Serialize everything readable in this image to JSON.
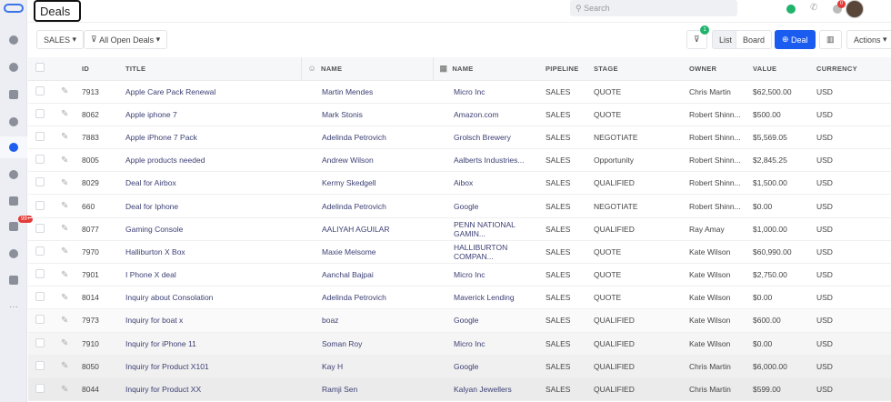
{
  "header": {
    "title": "Deals",
    "search_placeholder": "Search",
    "notification_count": "0"
  },
  "sidebar": {
    "badge": "99+",
    "items": [
      "home",
      "contacts",
      "companies",
      "tasks",
      "deals",
      "products",
      "email",
      "inbox",
      "chat",
      "reports",
      "more"
    ]
  },
  "toolbar": {
    "pipeline": "SALES",
    "filter_view": "All Open Deals",
    "filter_count": "1",
    "list": "List",
    "board": "Board",
    "add_deal": "Deal",
    "actions": "Actions"
  },
  "table": {
    "columns": [
      "ID",
      "TITLE",
      "NAME",
      "NAME",
      "PIPELINE",
      "STAGE",
      "OWNER",
      "VALUE",
      "CURRENCY"
    ],
    "rows": [
      [
        "7913",
        "Apple Care Pack Renewal",
        "Martin Mendes",
        "Micro Inc",
        "SALES",
        "QUOTE",
        "Chris Martin",
        "$62,500.00",
        "USD"
      ],
      [
        "8062",
        "Apple iphone 7",
        "Mark Stonis",
        "Amazon.com",
        "SALES",
        "QUOTE",
        "Robert Shinn...",
        "$500.00",
        "USD"
      ],
      [
        "7883",
        "Apple iPhone 7 Pack",
        "Adelinda Petrovich",
        "Grolsch Brewery",
        "SALES",
        "NEGOTIATE",
        "Robert Shinn...",
        "$5,569.05",
        "USD"
      ],
      [
        "8005",
        "Apple products needed",
        "Andrew Wilson",
        "Aalberts Industries...",
        "SALES",
        "Opportunity",
        "Robert Shinn...",
        "$2,845.25",
        "USD"
      ],
      [
        "8029",
        "Deal for Airbox",
        "Kermy Skedgell",
        "Aibox",
        "SALES",
        "QUALIFIED",
        "Robert Shinn...",
        "$1,500.00",
        "USD"
      ],
      [
        "660",
        "Deal for Iphone",
        "Adelinda Petrovich",
        "Google",
        "SALES",
        "NEGOTIATE",
        "Robert Shinn...",
        "$0.00",
        "USD"
      ],
      [
        "8077",
        "Gaming Console",
        "AALIYAH AGUILAR",
        "PENN NATIONAL GAMIN...",
        "SALES",
        "QUALIFIED",
        "Ray Amay",
        "$1,000.00",
        "USD"
      ],
      [
        "7970",
        "Halliburton X Box",
        "Maxie Melsome",
        "HALLIBURTON COMPAN...",
        "SALES",
        "QUOTE",
        "Kate Wilson",
        "$60,990.00",
        "USD"
      ],
      [
        "7901",
        "I Phone X deal",
        "Aanchal Bajpai",
        "Micro Inc",
        "SALES",
        "QUOTE",
        "Kate Wilson",
        "$2,750.00",
        "USD"
      ],
      [
        "8014",
        "Inquiry about Consolation",
        "Adelinda Petrovich",
        "Maverick Lending",
        "SALES",
        "QUOTE",
        "Kate Wilson",
        "$0.00",
        "USD"
      ],
      [
        "7973",
        "Inquiry for boat x",
        "boaz",
        "Google",
        "SALES",
        "QUALIFIED",
        "Kate Wilson",
        "$600.00",
        "USD"
      ],
      [
        "7910",
        "Inquiry for iPhone 11",
        "Soman Roy",
        "Micro Inc",
        "SALES",
        "QUALIFIED",
        "Kate Wilson",
        "$0.00",
        "USD"
      ],
      [
        "8050",
        "Inquiry for Product X101",
        "Kay H",
        "Google",
        "SALES",
        "QUALIFIED",
        "Chris Martin",
        "$6,000.00",
        "USD"
      ],
      [
        "8044",
        "Inquiry for Product XX",
        "Ramji Sen",
        "Kalyan Jewellers",
        "SALES",
        "QUALIFIED",
        "Chris Martin",
        "$599.00",
        "USD"
      ]
    ]
  },
  "colors": {
    "primary": "#1a5cf0",
    "badge_green": "#20b36b",
    "badge_red": "#e53935"
  }
}
